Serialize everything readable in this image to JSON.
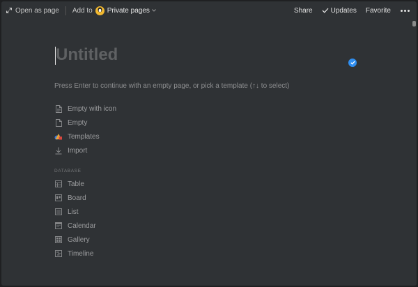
{
  "topbar": {
    "open_as_page": "Open as page",
    "add_to": "Add to",
    "private_pages": "Private pages",
    "share": "Share",
    "updates": "Updates",
    "favorite": "Favorite"
  },
  "page": {
    "title_placeholder": "Untitled",
    "hint": "Press Enter to continue with an empty page, or pick a template (↑↓ to select)"
  },
  "options": [
    {
      "label": "Empty with icon",
      "icon": "page-icon-with-icon"
    },
    {
      "label": "Empty",
      "icon": "page-icon"
    },
    {
      "label": "Templates",
      "icon": "templates-icon"
    },
    {
      "label": "Import",
      "icon": "import-icon"
    }
  ],
  "database": {
    "section_label": "DATABASE",
    "items": [
      {
        "label": "Table",
        "icon": "table-icon"
      },
      {
        "label": "Board",
        "icon": "board-icon"
      },
      {
        "label": "List",
        "icon": "list-icon"
      },
      {
        "label": "Calendar",
        "icon": "calendar-icon"
      },
      {
        "label": "Gallery",
        "icon": "gallery-icon"
      },
      {
        "label": "Timeline",
        "icon": "timeline-icon"
      }
    ]
  },
  "colors": {
    "background": "#2f3235",
    "accent_blue": "#2f8ef0",
    "avatar_yellow": "#f1b830"
  }
}
